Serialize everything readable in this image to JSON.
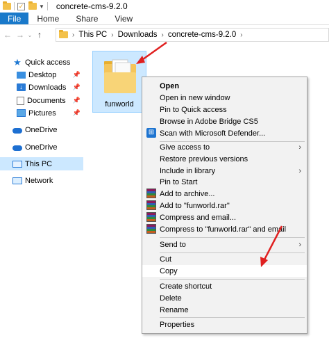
{
  "window": {
    "title": "concrete-cms-9.2.0"
  },
  "ribbon": {
    "tabs": [
      "File",
      "Home",
      "Share",
      "View"
    ]
  },
  "address": {
    "crumbs": [
      "This PC",
      "Downloads",
      "concrete-cms-9.2.0"
    ]
  },
  "nav_pane": {
    "quick_access": "Quick access",
    "desktop": "Desktop",
    "downloads": "Downloads",
    "documents": "Documents",
    "pictures": "Pictures",
    "onedrive1": "OneDrive",
    "onedrive2": "OneDrive",
    "this_pc": "This PC",
    "network": "Network"
  },
  "content": {
    "folder_name": "funworld"
  },
  "context_menu": {
    "open": "Open",
    "open_new_window": "Open in new window",
    "pin_quick_access": "Pin to Quick access",
    "browse_bridge": "Browse in Adobe Bridge CS5",
    "scan_defender": "Scan with Microsoft Defender...",
    "give_access": "Give access to",
    "restore_versions": "Restore previous versions",
    "include_library": "Include in library",
    "pin_start": "Pin to Start",
    "add_archive": "Add to archive...",
    "add_rar": "Add to \"funworld.rar\"",
    "compress_email": "Compress and email...",
    "compress_rar_email": "Compress to \"funworld.rar\" and email",
    "send_to": "Send to",
    "cut": "Cut",
    "copy": "Copy",
    "create_shortcut": "Create shortcut",
    "delete": "Delete",
    "rename": "Rename",
    "properties": "Properties"
  },
  "colors": {
    "accent": "#1979ca",
    "selection": "#cce8ff",
    "arrow": "#e02020"
  }
}
